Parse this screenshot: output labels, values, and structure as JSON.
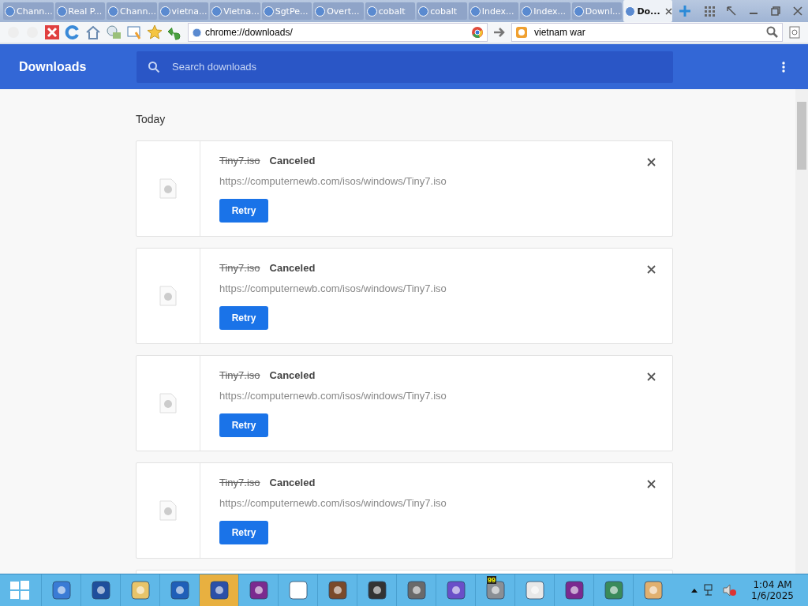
{
  "browser": {
    "tabs": [
      {
        "label": "Chann...",
        "selected": false
      },
      {
        "label": "Real P...",
        "selected": false
      },
      {
        "label": "Chann...",
        "selected": false
      },
      {
        "label": "vietna...",
        "selected": false
      },
      {
        "label": "Vietna...",
        "selected": false
      },
      {
        "label": "SgtPe...",
        "selected": false
      },
      {
        "label": "Overt...",
        "selected": false
      },
      {
        "label": "cobalt",
        "selected": false
      },
      {
        "label": "cobalt",
        "selected": false
      },
      {
        "label": "Index...",
        "selected": false
      },
      {
        "label": "Index...",
        "selected": false
      },
      {
        "label": "Downl...",
        "selected": false
      },
      {
        "label": "Do...",
        "selected": true
      }
    ],
    "address": "chrome://downloads/",
    "search_query": "vietnam war"
  },
  "header": {
    "title": "Downloads",
    "search_placeholder": "Search downloads"
  },
  "section": "Today",
  "downloads": [
    {
      "name": "Tiny7.iso",
      "canceled": true,
      "status": "Canceled",
      "url": "https://computernewb.com/isos/windows/Tiny7.iso",
      "button": "Retry"
    },
    {
      "name": "Tiny7.iso",
      "canceled": true,
      "status": "Canceled",
      "url": "https://computernewb.com/isos/windows/Tiny7.iso",
      "button": "Retry"
    },
    {
      "name": "Tiny7.iso",
      "canceled": true,
      "status": "Canceled",
      "url": "https://computernewb.com/isos/windows/Tiny7.iso",
      "button": "Retry"
    },
    {
      "name": "Tiny7.iso",
      "canceled": true,
      "status": "Canceled",
      "url": "https://computernewb.com/isos/windows/Tiny7.iso",
      "button": "Retry"
    }
  ],
  "taskbar": {
    "apps": [
      {
        "selected": false
      },
      {
        "selected": false
      },
      {
        "selected": false
      },
      {
        "selected": false
      },
      {
        "selected": true
      },
      {
        "selected": false
      },
      {
        "selected": false
      },
      {
        "selected": false
      },
      {
        "selected": false
      },
      {
        "selected": false
      },
      {
        "selected": false
      },
      {
        "selected": false,
        "badge": "99"
      },
      {
        "selected": false
      },
      {
        "selected": false
      },
      {
        "selected": false
      },
      {
        "selected": false
      }
    ],
    "time": "1:04 AM",
    "date": "1/6/2025"
  }
}
